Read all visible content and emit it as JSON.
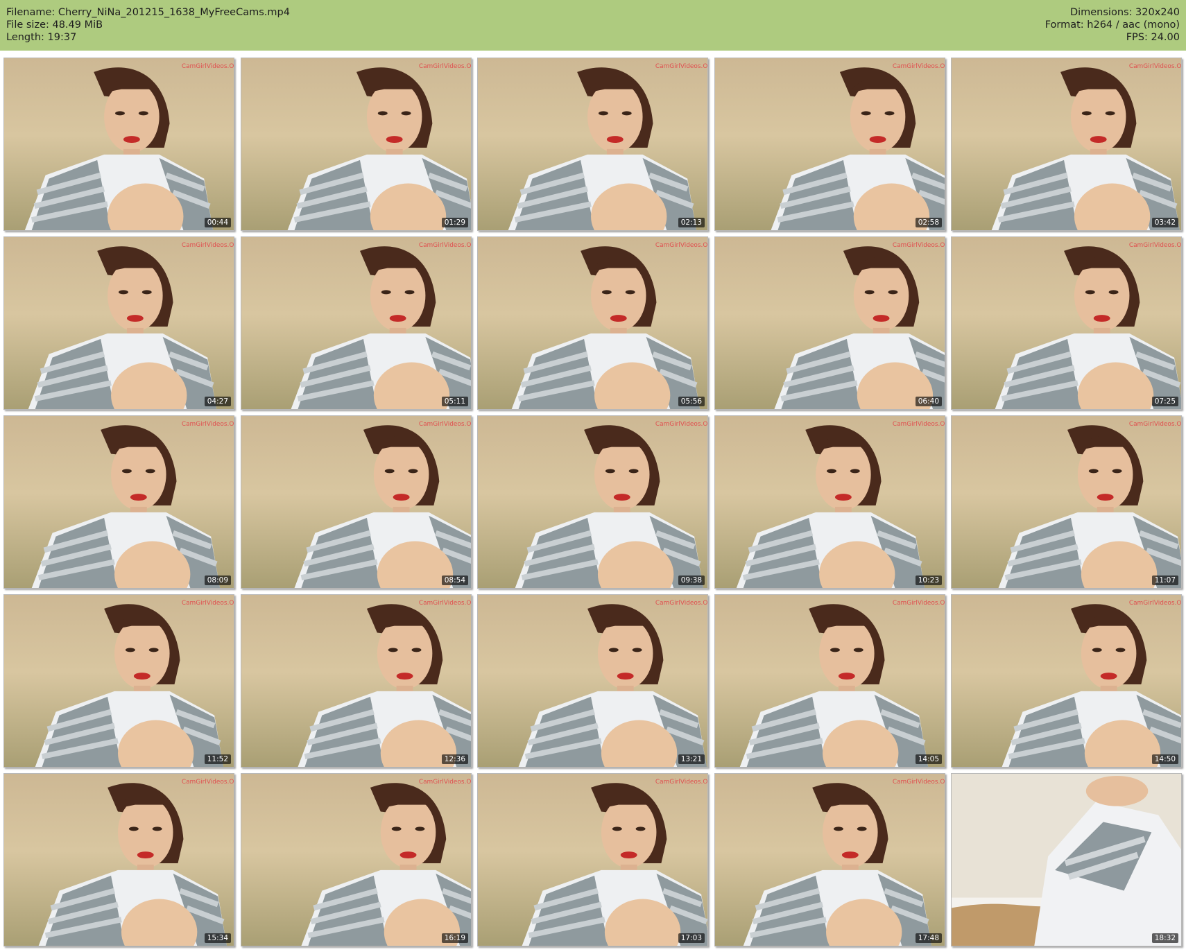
{
  "header": {
    "filename_line": "Filename: Cherry_NiNa_201215_1638_MyFreeCams.mp4",
    "filesize_line": "File size: 48.49 MiB",
    "length_line": "Length: 19:37",
    "dimensions_line": "Dimensions: 320x240",
    "format_line": "Format: h264 / aac (mono)",
    "fps_line": "FPS: 24.00"
  },
  "colors": {
    "header_bg": "#aecb7f",
    "background": "#ffffff"
  },
  "thumbnails": [
    {
      "timestamp": "00:44"
    },
    {
      "timestamp": "01:29"
    },
    {
      "timestamp": "02:13"
    },
    {
      "timestamp": "02:58"
    },
    {
      "timestamp": "03:42"
    },
    {
      "timestamp": "04:27"
    },
    {
      "timestamp": "05:11"
    },
    {
      "timestamp": "05:56"
    },
    {
      "timestamp": "06:40"
    },
    {
      "timestamp": "07:25"
    },
    {
      "timestamp": "08:09"
    },
    {
      "timestamp": "08:54"
    },
    {
      "timestamp": "09:38"
    },
    {
      "timestamp": "10:23"
    },
    {
      "timestamp": "11:07"
    },
    {
      "timestamp": "11:52"
    },
    {
      "timestamp": "12:36"
    },
    {
      "timestamp": "13:21"
    },
    {
      "timestamp": "14:05"
    },
    {
      "timestamp": "14:50"
    },
    {
      "timestamp": "15:34"
    },
    {
      "timestamp": "16:19"
    },
    {
      "timestamp": "17:03"
    },
    {
      "timestamp": "17:48"
    },
    {
      "timestamp": "18:32"
    }
  ]
}
